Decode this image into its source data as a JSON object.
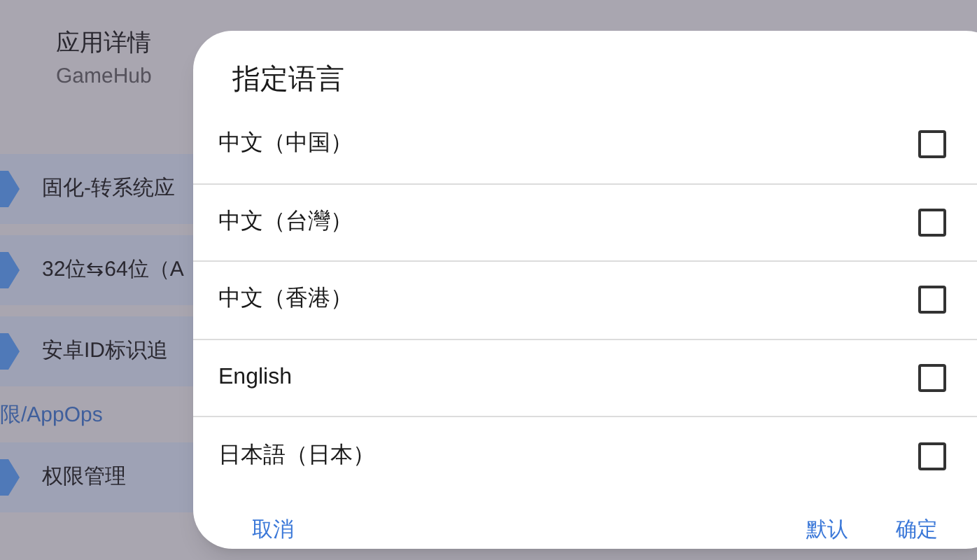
{
  "header": {
    "title": "应用详情",
    "subtitle": "GameHub"
  },
  "background_items": [
    {
      "kind": "item",
      "label": "固化-转系统应"
    },
    {
      "kind": "item",
      "label": "32位⇆64位（A"
    },
    {
      "kind": "item",
      "label": "安卓ID标识追"
    },
    {
      "kind": "section",
      "label": "限/AppOps"
    },
    {
      "kind": "item",
      "label": "权限管理"
    }
  ],
  "dialog": {
    "title": "指定语言",
    "options": [
      {
        "label": "中文（中国）",
        "checked": false
      },
      {
        "label": "中文（台灣）",
        "checked": false
      },
      {
        "label": "中文（香港）",
        "checked": false
      },
      {
        "label": "English",
        "checked": false
      },
      {
        "label": "日本語（日本）",
        "checked": false
      }
    ],
    "buttons": {
      "left": [
        "取消"
      ],
      "right": [
        "默认",
        "确定"
      ]
    }
  }
}
